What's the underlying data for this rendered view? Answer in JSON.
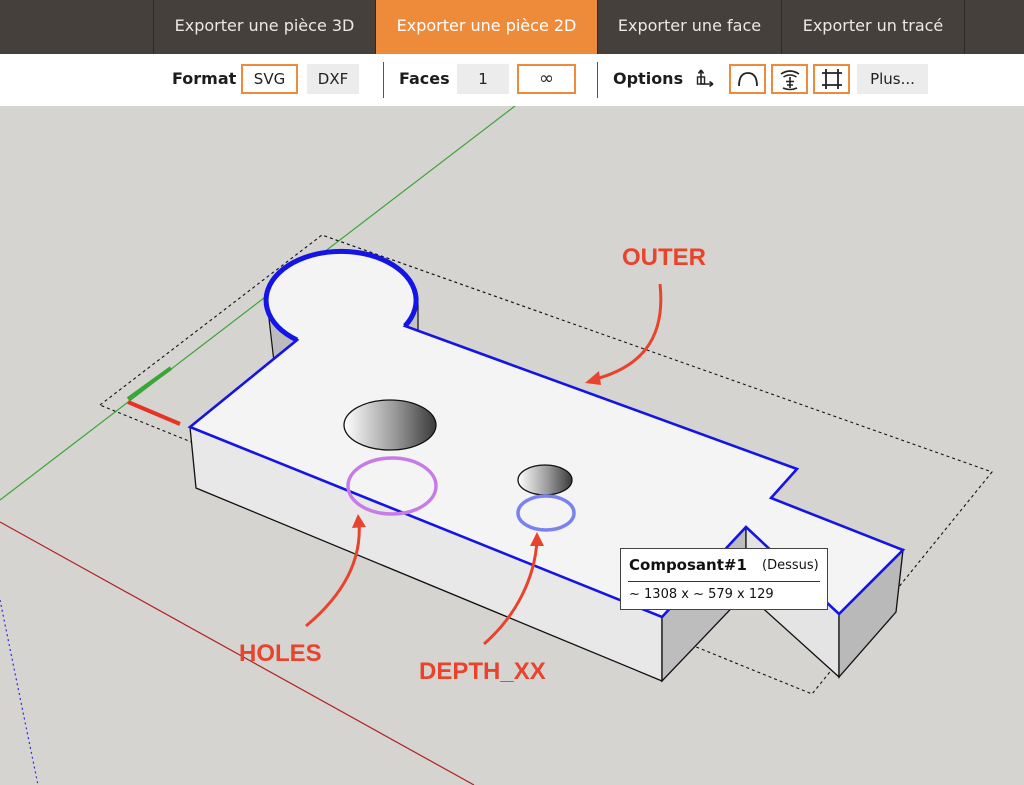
{
  "tabs": [
    {
      "label": "Exporter une pièce 3D",
      "active": false
    },
    {
      "label": "Exporter une pièce 2D",
      "active": true
    },
    {
      "label": "Exporter une face",
      "active": false
    },
    {
      "label": "Exporter un tracé",
      "active": false
    }
  ],
  "toolbar": {
    "format_label": "Format",
    "format_svg": "SVG",
    "format_dxf": "DXF",
    "format_selected": "SVG",
    "faces_label": "Faces",
    "faces_one": "1",
    "faces_infinite": "∞",
    "faces_selected": "∞",
    "options_label": "Options",
    "more_label": "Plus...",
    "option_icons": [
      "anchor-axes-icon",
      "curve-arc-icon",
      "depth-layers-icon",
      "bounding-box-icon"
    ]
  },
  "annotations": {
    "outer": "OUTER",
    "holes": "HOLES",
    "depth": "DEPTH_XX"
  },
  "tooltip": {
    "title": "Composant#1",
    "view": "(Dessus)",
    "dims": "~ 1308 x ~ 579 x 129"
  },
  "colors": {
    "accent": "#ee8b3b",
    "topbar": "#45403b",
    "outer_outline": "#1414e6",
    "holes_outline": "#c77be6",
    "depth_outline": "#7a82f0",
    "annotation": "#e8432d",
    "axis_green": "#3aa636",
    "axis_red": "#e63422",
    "axis_blue": "#2b2be0"
  }
}
